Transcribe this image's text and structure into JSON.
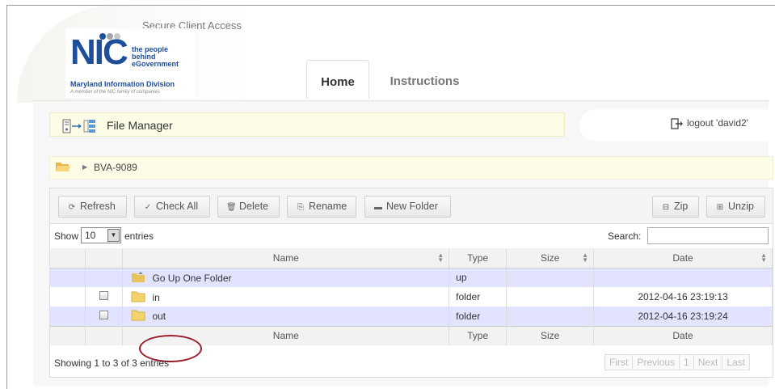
{
  "header": {
    "title": "Secure Client Access",
    "logo": {
      "wordmark": "NIC",
      "tagline_1": "the people",
      "tagline_2": "behind",
      "tagline_3": "eGovernment",
      "division": "Maryland Information Division",
      "subline": "A member of the NIC family of companies"
    }
  },
  "tabs": [
    {
      "label": "Home",
      "active": true
    },
    {
      "label": "Instructions",
      "active": false
    }
  ],
  "file_manager": {
    "title": "File Manager",
    "logout_label": "logout 'david2'",
    "breadcrumb": "BVA-9089"
  },
  "toolbar": {
    "refresh": "Refresh",
    "check_all": "Check All",
    "delete": "Delete",
    "rename": "Rename",
    "new_folder": "New Folder",
    "zip": "Zip",
    "unzip": "Unzip"
  },
  "table_controls": {
    "show_label": "Show",
    "show_value": "10",
    "entries_label": "entries",
    "search_label": "Search:",
    "search_value": ""
  },
  "columns": [
    "Name",
    "Type",
    "Size",
    "Date"
  ],
  "rows": [
    {
      "checkbox": false,
      "name": "Go Up One Folder",
      "type": "up",
      "size": "",
      "date": ""
    },
    {
      "checkbox": true,
      "name": "in",
      "type": "folder",
      "size": "",
      "date": "2012-04-16 23:19:13"
    },
    {
      "checkbox": true,
      "name": "out",
      "type": "folder",
      "size": "",
      "date": "2012-04-16 23:19:24"
    }
  ],
  "footer": {
    "info": "Showing 1 to 3 of 3 entries",
    "pager": {
      "first": "First",
      "previous": "Previous",
      "page": "1",
      "next": "Next",
      "last": "Last"
    }
  },
  "colors": {
    "brand_blue": "#1d4f9a",
    "highlight_row": "#e2e4ff",
    "annotation_circle": "#9b1c2a",
    "folder_yellow": "#f3d36b"
  }
}
